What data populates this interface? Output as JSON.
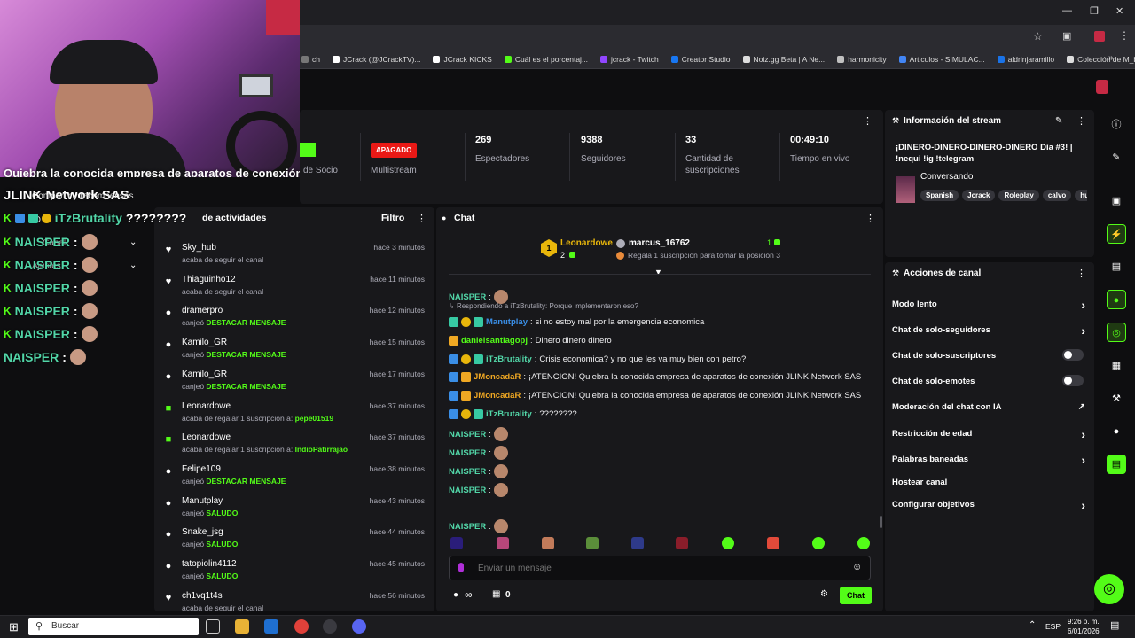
{
  "browser": {
    "bookmarks": [
      "ch",
      "JCrack (@JCrackTV)...",
      "JCrack KICKS",
      "Cuál es el porcentaj...",
      "jcrack - Twitch",
      "Creator Studio",
      "Noiz.gg Beta | A Ne...",
      "harmonicity",
      "Articulos - SIMULAC...",
      "aldrinjaramillo",
      "Colección de M_blei..."
    ]
  },
  "stats": {
    "socio_label": "de Socio",
    "apagado_badge": "APAGADO",
    "multistream_label": "Multistream",
    "espectadores": {
      "value": "269",
      "label": "Espectadores"
    },
    "seguidores": {
      "value": "9388",
      "label": "Seguidores"
    },
    "suscripciones": {
      "value": "33",
      "label": "Cantidad de suscripciones"
    },
    "tiempo": {
      "value": "00:49:10",
      "label": "Tiempo en vivo"
    }
  },
  "overlay": {
    "line1": "JLINK Network SAS",
    "line1_top": "Quiebra la conocida empresa de aparatos de conexión",
    "brutality": "iTzBrutality",
    "brutality_msg": "????????",
    "naisper": "NAISPER",
    "menu_compartir": "Compartir y recompensas",
    "menu_canal": "Canal",
    "menu_ajustes": "Ajustes",
    "menu_id": "ID"
  },
  "activity": {
    "title": "de actividades",
    "filtro": "Filtro",
    "items": [
      {
        "icon": "heart",
        "name": "Sky_hub",
        "desc": "acaba de seguir el canal",
        "hl": "",
        "time": "hace 3 minutos"
      },
      {
        "icon": "heart",
        "name": "Thiaguinho12",
        "desc": "acaba de seguir el canal",
        "hl": "",
        "time": "hace 11 minutos"
      },
      {
        "icon": "dots",
        "name": "dramerpro",
        "desc": "canjeó ",
        "hl": "DESTACAR MENSAJE",
        "time": "hace 12 minutos"
      },
      {
        "icon": "dots",
        "name": "Kamilo_GR",
        "desc": "canjeó ",
        "hl": "DESTACAR MENSAJE",
        "time": "hace 15 minutos"
      },
      {
        "icon": "dots",
        "name": "Kamilo_GR",
        "desc": "canjeó ",
        "hl": "DESTACAR MENSAJE",
        "time": "hace 17 minutos"
      },
      {
        "icon": "gift",
        "name": "Leonardowe",
        "desc": "acaba de regalar 1 suscripción a: ",
        "hl": "pepe01519",
        "time": "hace 37 minutos"
      },
      {
        "icon": "gift",
        "name": "Leonardowe",
        "desc": "acaba de regalar 1 suscripción a: ",
        "hl": "IndioPatirrajao",
        "time": "hace 37 minutos"
      },
      {
        "icon": "dots",
        "name": "Felipe109",
        "desc": "canjeó ",
        "hl": "DESTACAR MENSAJE",
        "time": "hace 38 minutos"
      },
      {
        "icon": "dots",
        "name": "Manutplay",
        "desc": "canjeó ",
        "hl": "SALUDO",
        "time": "hace 43 minutos"
      },
      {
        "icon": "dots",
        "name": "Snake_jsg",
        "desc": "canjeó ",
        "hl": "SALUDO",
        "time": "hace 44 minutos"
      },
      {
        "icon": "dots",
        "name": "tatopiolin4112",
        "desc": "canjeó ",
        "hl": "SALUDO",
        "time": "hace 45 minutos"
      },
      {
        "icon": "heart",
        "name": "ch1vq1t4s",
        "desc": "acaba de seguir el canal",
        "hl": "",
        "time": "hace 56 minutos"
      }
    ]
  },
  "chat": {
    "title": "Chat",
    "top1": {
      "name": "Leonardowe",
      "count": "2"
    },
    "top2": {
      "name": "marcus_16762",
      "count": "1"
    },
    "top_hint": "Regala 1 suscripción para tomar la posición 3",
    "reply_hint": "Respondiendo a iTzBrutality: Porque implementaron eso?",
    "messages": [
      {
        "user": "NAISPER",
        "color": "#52d6a8",
        "text": "",
        "emote": true
      },
      {
        "user": "Manutplay",
        "color": "#3a8ee6",
        "text": "si no estoy mal por la emergencia economica",
        "emote": false
      },
      {
        "user": "danielsantiagopj",
        "color": "#53fc18",
        "text": "Dinero dinero dinero",
        "emote": false
      },
      {
        "user": "iTzBrutality",
        "color": "#52d6a8",
        "text": "Crisis economica? y no que les va muy bien con petro?",
        "emote": false
      },
      {
        "user": "JMoncadaR",
        "color": "#f0a823",
        "text": "¡ATENCION! Quiebra la conocida empresa de aparatos de conexión JLINK Network SAS",
        "emote": false
      },
      {
        "user": "JMoncadaR",
        "color": "#f0a823",
        "text": "¡ATENCION! Quiebra la conocida empresa de aparatos de conexión JLINK Network SAS",
        "emote": false
      },
      {
        "user": "iTzBrutality",
        "color": "#52d6a8",
        "text": "????????",
        "emote": false
      },
      {
        "user": "NAISPER",
        "color": "#52d6a8",
        "text": "",
        "emote": true
      },
      {
        "user": "NAISPER",
        "color": "#52d6a8",
        "text": "",
        "emote": true
      },
      {
        "user": "NAISPER",
        "color": "#52d6a8",
        "text": "",
        "emote": true
      },
      {
        "user": "NAISPER",
        "color": "#52d6a8",
        "text": "",
        "emote": true
      },
      {
        "user": "NAISPER",
        "color": "#52d6a8",
        "text": "",
        "emote": true
      }
    ],
    "input_placeholder": "Enviar un mensaje",
    "infinity": "∞",
    "count": "0",
    "send_label": "Chat"
  },
  "info": {
    "title": "Información del stream",
    "stream_title": "¡DINERO-DINERO-DINERO-DINERO Día #3! | !nequi !ig !telegram",
    "category": "Conversando",
    "tags": [
      "Spanish",
      "Jcrack",
      "Roleplay",
      "calvo",
      "hu"
    ]
  },
  "actions": {
    "title": "Acciones de canal",
    "rows": [
      {
        "label": "Modo lento",
        "type": "chevron"
      },
      {
        "label": "Chat de solo-seguidores",
        "type": "chevron"
      },
      {
        "label": "Chat de solo-suscriptores",
        "type": "toggle"
      },
      {
        "label": "Chat de solo-emotes",
        "type": "toggle"
      },
      {
        "label": "Moderación del chat con IA",
        "type": "external"
      },
      {
        "label": "Restricción de edad",
        "type": "chevron"
      },
      {
        "label": "Palabras baneadas",
        "type": "chevron"
      },
      {
        "label": "Hostear canal",
        "type": "none"
      },
      {
        "label": "Configurar objetivos",
        "type": "chevron"
      }
    ]
  },
  "taskbar": {
    "search": "Buscar",
    "lang": "ESP",
    "time": "9:26 p. m.",
    "date": "6/01/2026"
  },
  "colors": {
    "kick_green": "#53fc18",
    "apagado_red": "#e91916",
    "panel_bg": "#18181b"
  }
}
